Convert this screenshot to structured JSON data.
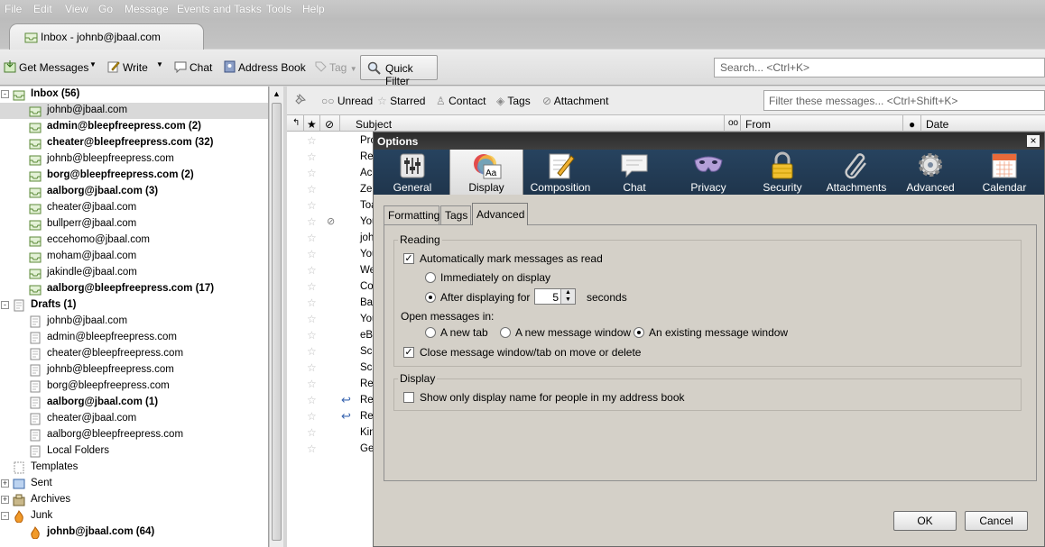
{
  "menubar": {
    "items": [
      "File",
      "Edit",
      "View",
      "Go",
      "Message",
      "Events and Tasks",
      "Tools",
      "Help"
    ]
  },
  "tab": {
    "title": "Inbox - johnb@jbaal.com"
  },
  "toolbar": {
    "get_messages": "Get Messages",
    "write": "Write",
    "chat": "Chat",
    "address_book": "Address Book",
    "tag": "Tag",
    "quick_filter": "Quick Filter",
    "search_placeholder": "Search... <Ctrl+K>"
  },
  "folders": [
    {
      "label": "Inbox (56)",
      "bold": true,
      "level": 0,
      "twisty": "-"
    },
    {
      "label": "johnb@jbaal.com",
      "bold": false,
      "level": 1,
      "selected": true
    },
    {
      "label": "admin@bleepfreepress.com (2)",
      "bold": true,
      "level": 1
    },
    {
      "label": "cheater@bleepfreepress.com (32)",
      "bold": true,
      "level": 1
    },
    {
      "label": "johnb@bleepfreepress.com",
      "bold": false,
      "level": 1
    },
    {
      "label": "borg@bleepfreepress.com (2)",
      "bold": true,
      "level": 1
    },
    {
      "label": "aalborg@jbaal.com (3)",
      "bold": true,
      "level": 1
    },
    {
      "label": "cheater@jbaal.com",
      "bold": false,
      "level": 1
    },
    {
      "label": "bullperr@jbaal.com",
      "bold": false,
      "level": 1
    },
    {
      "label": "eccehomo@jbaal.com",
      "bold": false,
      "level": 1
    },
    {
      "label": "moham@jbaal.com",
      "bold": false,
      "level": 1
    },
    {
      "label": "jakindle@jbaal.com",
      "bold": false,
      "level": 1
    },
    {
      "label": "aalborg@bleepfreepress.com (17)",
      "bold": true,
      "level": 1
    },
    {
      "label": "Drafts (1)",
      "bold": true,
      "level": 0,
      "twisty": "-"
    },
    {
      "label": "johnb@jbaal.com",
      "bold": false,
      "level": 1
    },
    {
      "label": "admin@bleepfreepress.com",
      "bold": false,
      "level": 1
    },
    {
      "label": "cheater@bleepfreepress.com",
      "bold": false,
      "level": 1
    },
    {
      "label": "johnb@bleepfreepress.com",
      "bold": false,
      "level": 1
    },
    {
      "label": "borg@bleepfreepress.com",
      "bold": false,
      "level": 1
    },
    {
      "label": "aalborg@jbaal.com (1)",
      "bold": true,
      "level": 1
    },
    {
      "label": "cheater@jbaal.com",
      "bold": false,
      "level": 1
    },
    {
      "label": "aalborg@bleepfreepress.com",
      "bold": false,
      "level": 1
    },
    {
      "label": "Local Folders",
      "bold": false,
      "level": 1
    },
    {
      "label": "Templates",
      "bold": false,
      "level": 0
    },
    {
      "label": "Sent",
      "bold": false,
      "level": 0,
      "twisty": "+"
    },
    {
      "label": "Archives",
      "bold": false,
      "level": 0,
      "twisty": "+"
    },
    {
      "label": "Junk",
      "bold": false,
      "level": 0,
      "twisty": "-"
    },
    {
      "label": "johnb@jbaal.com (64)",
      "bold": true,
      "level": 1
    }
  ],
  "filterbar": {
    "unread": "Unread",
    "starred": "Starred",
    "contact": "Contact",
    "tags": "Tags",
    "attachment": "Attachment",
    "filter_placeholder": "Filter these messages... <Ctrl+Shift+K>"
  },
  "columns": {
    "subject": "Subject",
    "from": "From",
    "date": "Date"
  },
  "messages": [
    "Pro",
    "Re",
    "Ac",
    "Zer",
    "Toa",
    "You",
    "joh",
    "You",
    "We",
    "Co",
    "Bar",
    "You",
    "eBa",
    "Scr",
    "Scr",
    "Re",
    "Re",
    "Re",
    "Kin",
    "Ge"
  ],
  "dialog": {
    "title": "Options",
    "close": "×",
    "panes": [
      "General",
      "Display",
      "Composition",
      "Chat",
      "Privacy",
      "Security",
      "Attachments",
      "Advanced",
      "Calendar"
    ],
    "selected_pane": "Display",
    "subtabs": [
      "Formatting",
      "Tags",
      "Advanced"
    ],
    "selected_subtab": "Advanced",
    "reading": {
      "legend": "Reading",
      "auto_mark": "Automatically mark messages as read",
      "immediately": "Immediately on display",
      "after_displaying": "After displaying for",
      "seconds_value": "5",
      "seconds": "seconds",
      "open_in": "Open messages in:",
      "new_tab": "A new tab",
      "new_window": "A new message window",
      "existing_window": "An existing message window",
      "close_window": "Close message window/tab on move or delete"
    },
    "display": {
      "legend": "Display",
      "only_display_name": "Show only display name for people in my address book"
    },
    "ok": "OK",
    "cancel": "Cancel"
  },
  "colors": {
    "pref_bar": "#23405a",
    "title_bar": "#333333",
    "dialog_bg": "#d4d0c8"
  }
}
